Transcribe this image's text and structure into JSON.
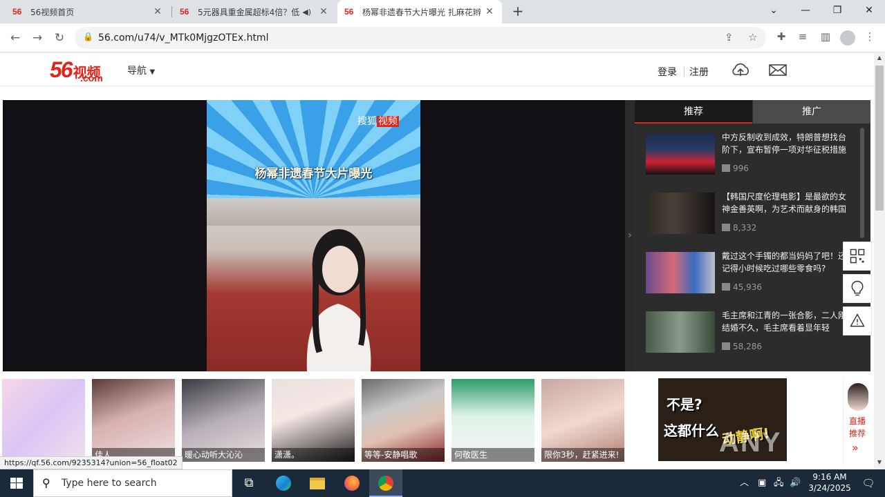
{
  "browser": {
    "tabs": [
      {
        "icon": "56",
        "title": "56视频首页"
      },
      {
        "icon": "56",
        "title": "5元器具重金属超标4倍？低"
      },
      {
        "icon": "56",
        "title": "杨幂非遗春节大片曝光 扎麻花辫"
      }
    ],
    "url": "56.com/u74/v_MTk0MjgzOTEx.html",
    "status_url": "https://qf.56.com/9235314?union=56_float02"
  },
  "site": {
    "logo_number": "56",
    "logo_cn": "视频",
    "logo_com": ".com",
    "nav_label": "导航",
    "login": "登录",
    "register": "注册"
  },
  "player": {
    "video_title": "杨幂非遗春节大片曝光",
    "watermark_a": "搜狐",
    "watermark_b": "视频"
  },
  "panel": {
    "tab_recommend": "推荐",
    "tab_promote": "推广",
    "items": [
      {
        "title": "中方反制收到成效，特朗普想找台阶下，宣布暂停一项对华征税措施",
        "views": "996"
      },
      {
        "title": "【韩国尺度伦理电影】是最欲的女神金善英啊，为艺术而献身的韩国",
        "views": "8,332"
      },
      {
        "title": "戴过这个手镯的都当妈妈了吧！还记得小时候吃过哪些零食吗?",
        "views": "45,936"
      },
      {
        "title": "毛主席和江青的一张合影，二人刚结婚不久，毛主席看着显年轻",
        "views": "58,286"
      }
    ]
  },
  "strip": {
    "items": [
      {
        "caption": ""
      },
      {
        "caption": "佳人"
      },
      {
        "caption": "暖心动听大沁沁"
      },
      {
        "caption": "潇潇。"
      },
      {
        "caption": "等等-安静唱歌"
      },
      {
        "caption": "何敬医生"
      },
      {
        "caption": "限你3秒，赶紧进来!"
      }
    ],
    "ad_text_1": "不是?",
    "ad_text_2": "这都什么",
    "ad_text_3": "动静啊!",
    "live_label": "直播推荐",
    "brand_watermark": "ANY RUN"
  },
  "taskbar": {
    "search_placeholder": "Type here to search",
    "time": "9:16 AM",
    "date": "3/24/2025"
  },
  "colors": {
    "brand": "#e0261a",
    "player_bg": "#121014",
    "panel_bg": "#2c2c2c",
    "taskbar": "#1b2a3a"
  }
}
